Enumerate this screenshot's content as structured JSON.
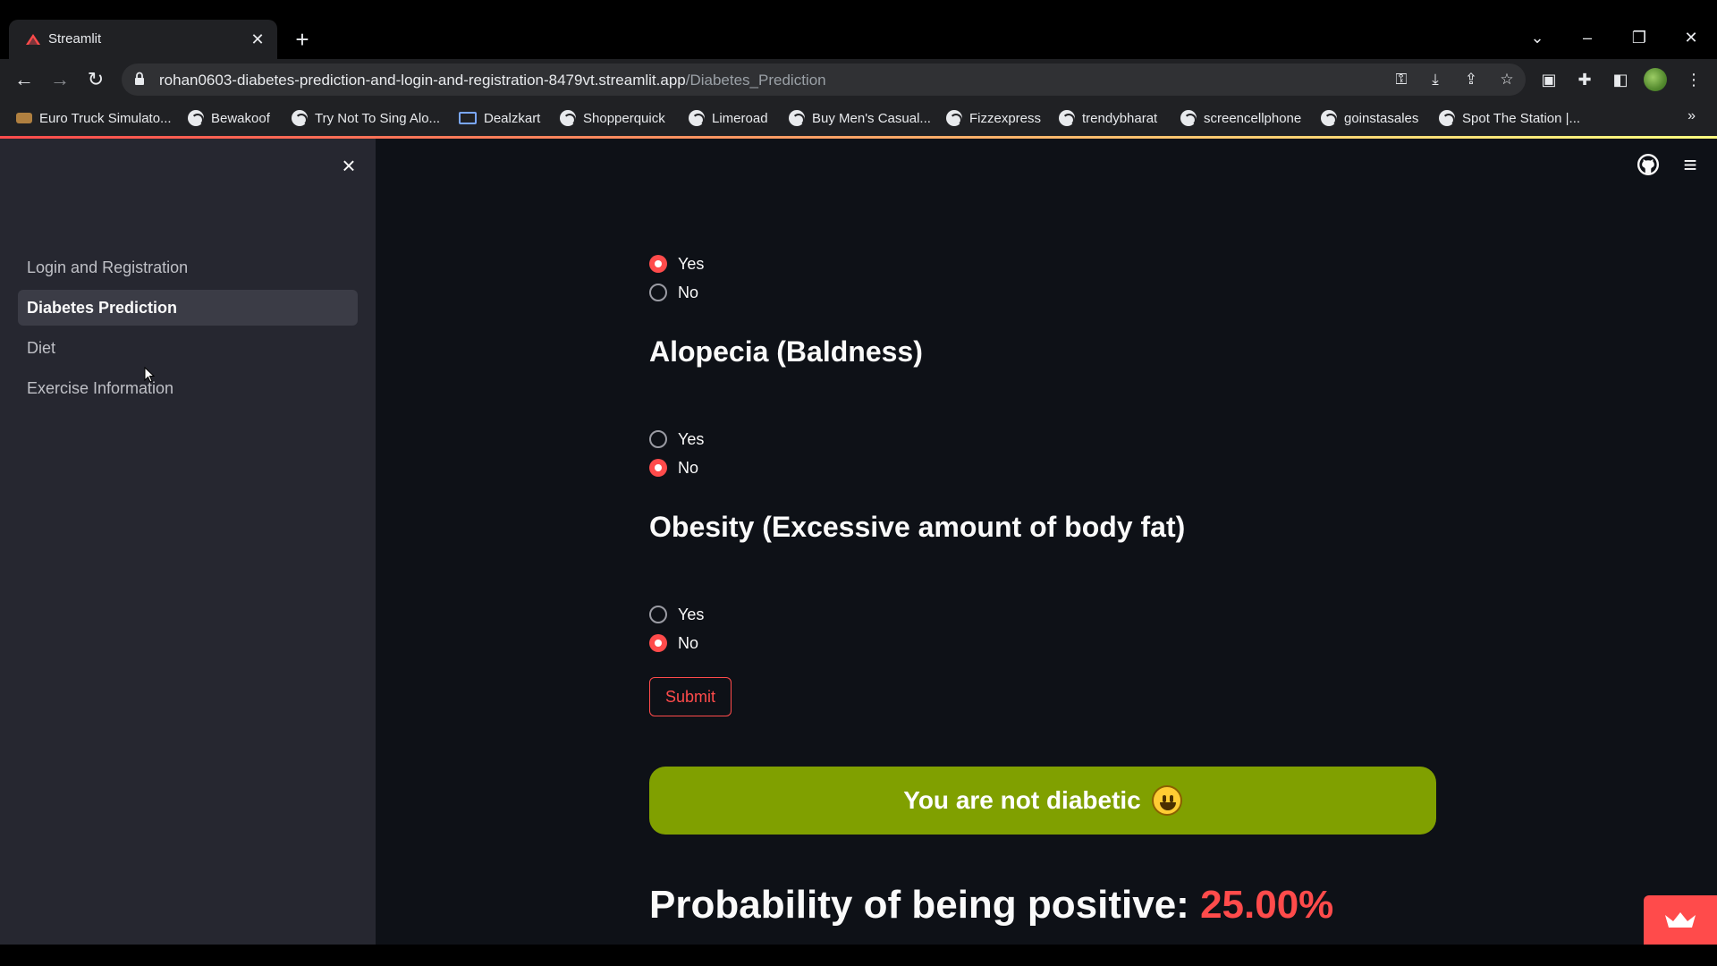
{
  "browser": {
    "tab_title": "Streamlit",
    "url_host": "rohan0603-diabetes-prediction-and-login-and-registration-8479vt.streamlit.app",
    "url_path": "/Diabetes_Prediction",
    "bookmarks": [
      "Euro Truck Simulato...",
      "Bewakoof",
      "Try Not To Sing Alo...",
      "Dealzkart",
      "Shopperquick",
      "Limeroad",
      "Buy Men's Casual...",
      "Fizzexpress",
      "trendybharat",
      "screencellphone",
      "goinstasales",
      "Spot The Station |..."
    ]
  },
  "sidebar": {
    "items": [
      {
        "label": "Login and Registration",
        "active": false
      },
      {
        "label": "Diabetes Prediction",
        "active": true
      },
      {
        "label": "Diet",
        "active": false
      },
      {
        "label": "Exercise Information",
        "active": false
      }
    ]
  },
  "form": {
    "previous_question": {
      "options": [
        "Yes",
        "No"
      ],
      "selected": "Yes"
    },
    "alopecia": {
      "title": "Alopecia (Baldness)",
      "options": [
        "Yes",
        "No"
      ],
      "selected": "No"
    },
    "obesity": {
      "title": "Obesity (Excessive amount of body fat)",
      "options": [
        "Yes",
        "No"
      ],
      "selected": "No"
    },
    "submit_label": "Submit"
  },
  "result": {
    "message": "You are not diabetic",
    "emoji": "smiley-face",
    "probability_label": "Probability of being positive:",
    "probability_value": "25.00%"
  },
  "colors": {
    "primary": "#ff4b4b",
    "success_banner": "#80a000",
    "sidebar_bg": "#262730",
    "main_bg": "#0e1117"
  }
}
